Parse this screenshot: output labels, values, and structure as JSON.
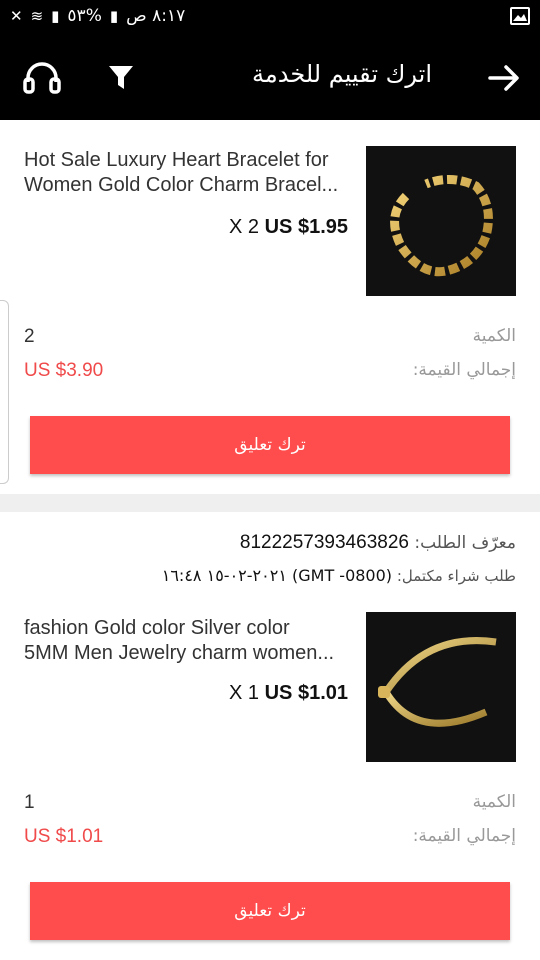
{
  "status_bar": {
    "time": "٨:١٧ ص",
    "battery": "%٥٣"
  },
  "app_bar": {
    "title": "اترك تقييم للخدمة",
    "icons": [
      "back-arrow-icon",
      "filter-icon",
      "headset-icon"
    ]
  },
  "orders": [
    {
      "product_name_line1": "Hot Sale Luxury Heart Bracelet for",
      "product_name_line2": "Women Gold Color Charm Bracel...",
      "qty_price": "X 2",
      "unit_price": "US $1.95",
      "quantity_label": "الكمية",
      "quantity_value": "2",
      "total_label": "إجمالي القيمة:",
      "total_value": "US $3.90",
      "button_label": "ترك تعليق"
    },
    {
      "order_id_label": "معرّف الطلب:",
      "order_id": "8122257393463826",
      "order_date_label": "طلب شراء مكتمل:",
      "order_date": "(GMT -0800) ٢٠٢١-٠٢-١٥ ١٦:٤٨",
      "product_name_line1": "fashion Gold color Silver color",
      "product_name_line2": "5MM Men Jewelry charm women...",
      "qty_price": "X 1",
      "unit_price": "US $1.01",
      "quantity_label": "الكمية",
      "quantity_value": "1",
      "total_label": "إجمالي القيمة:",
      "total_value": "US $1.01",
      "button_label": "ترك تعليق"
    }
  ],
  "colors": {
    "accent": "#ff4c4c",
    "price_red": "#f04a4a",
    "bar": "#000000"
  }
}
